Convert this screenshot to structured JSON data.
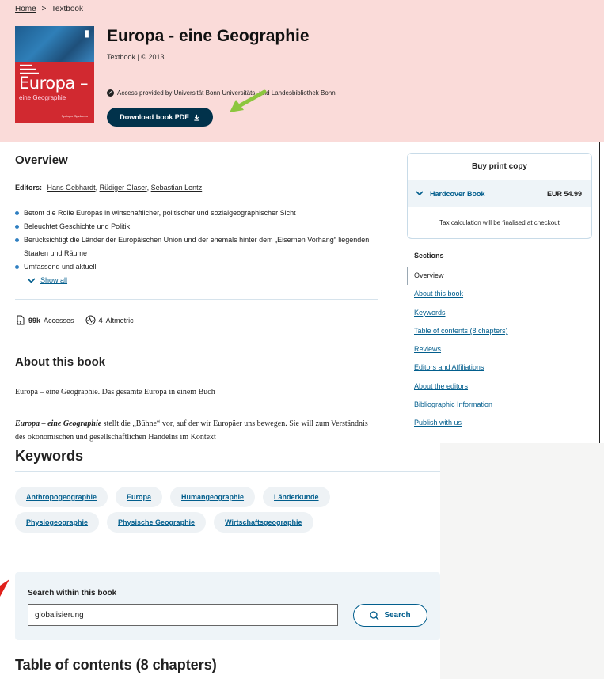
{
  "breadcrumb": {
    "home": "Home",
    "separator": ">",
    "current": "Textbook"
  },
  "book": {
    "title": "Europa - eine Geographie",
    "meta": "Textbook | © 2013",
    "access_text": "Access provided by Universität Bonn Universitäts- und Landesbibliothek Bonn",
    "download_label": "Download book PDF",
    "cover": {
      "title": "Europa –",
      "subtitle": "eine Geographie",
      "publisher_mark": "Springer Spektrum"
    }
  },
  "overview": {
    "heading": "Overview",
    "editors_label": "Editors:",
    "editors": [
      "Hans Gebhardt",
      "Rüdiger Glaser",
      "Sebastian Lentz"
    ],
    "bullets": [
      "Betont die Rolle Europas in wirtschaftlicher, politischer und sozialgeographischer Sicht",
      "Beleuchtet Geschichte und Politik",
      "Berücksichtigt die Länder der Europäischen Union und der ehemals hinter dem „Eisernen Vorhang“ liegenden Staaten und Räume",
      "Umfassend und aktuell"
    ],
    "show_all": "Show all",
    "accesses_count": "99k",
    "accesses_label": "Accesses",
    "altmetric_count": "4",
    "altmetric_label": "Altmetric"
  },
  "about": {
    "heading": "About this book",
    "p1": "Europa – eine Geographie. Das gesamte Europa in einem Buch",
    "p2_em": "Europa – eine Geographie",
    "p2_rest": " stellt die „Bühne“ vor, auf der wir Europäer uns bewegen. Sie will zum Verständnis des ökonomischen und gesellschaftlichen Handelns im Kontext"
  },
  "buy": {
    "title": "Buy print copy",
    "format": "Hardcover Book",
    "price": "EUR 54.99",
    "tax_note": "Tax calculation will be finalised at checkout"
  },
  "sections": {
    "heading": "Sections",
    "items": [
      "Overview",
      "About this book",
      "Keywords",
      "Table of contents (8 chapters)",
      "Reviews",
      "Editors and Affiliations",
      "About the editors",
      "Bibliographic Information",
      "Publish with us"
    ]
  },
  "keywords": {
    "heading": "Keywords",
    "row1": [
      "Anthropogeographie",
      "Europa",
      "Humangeographie",
      "Länderkunde"
    ],
    "row2": [
      "Physiogeographie",
      "Physische Geographie",
      "Wirtschaftsgeographie"
    ]
  },
  "search": {
    "label": "Search within this book",
    "value": "globalisierung",
    "button": "Search"
  },
  "toc": {
    "heading": "Table of contents (8 chapters)"
  },
  "colors": {
    "hero_bg": "#fadbd9",
    "primary": "#01324b",
    "link": "#025e8d",
    "annotation_green": "#8cc63f",
    "annotation_red": "#e0201b"
  }
}
